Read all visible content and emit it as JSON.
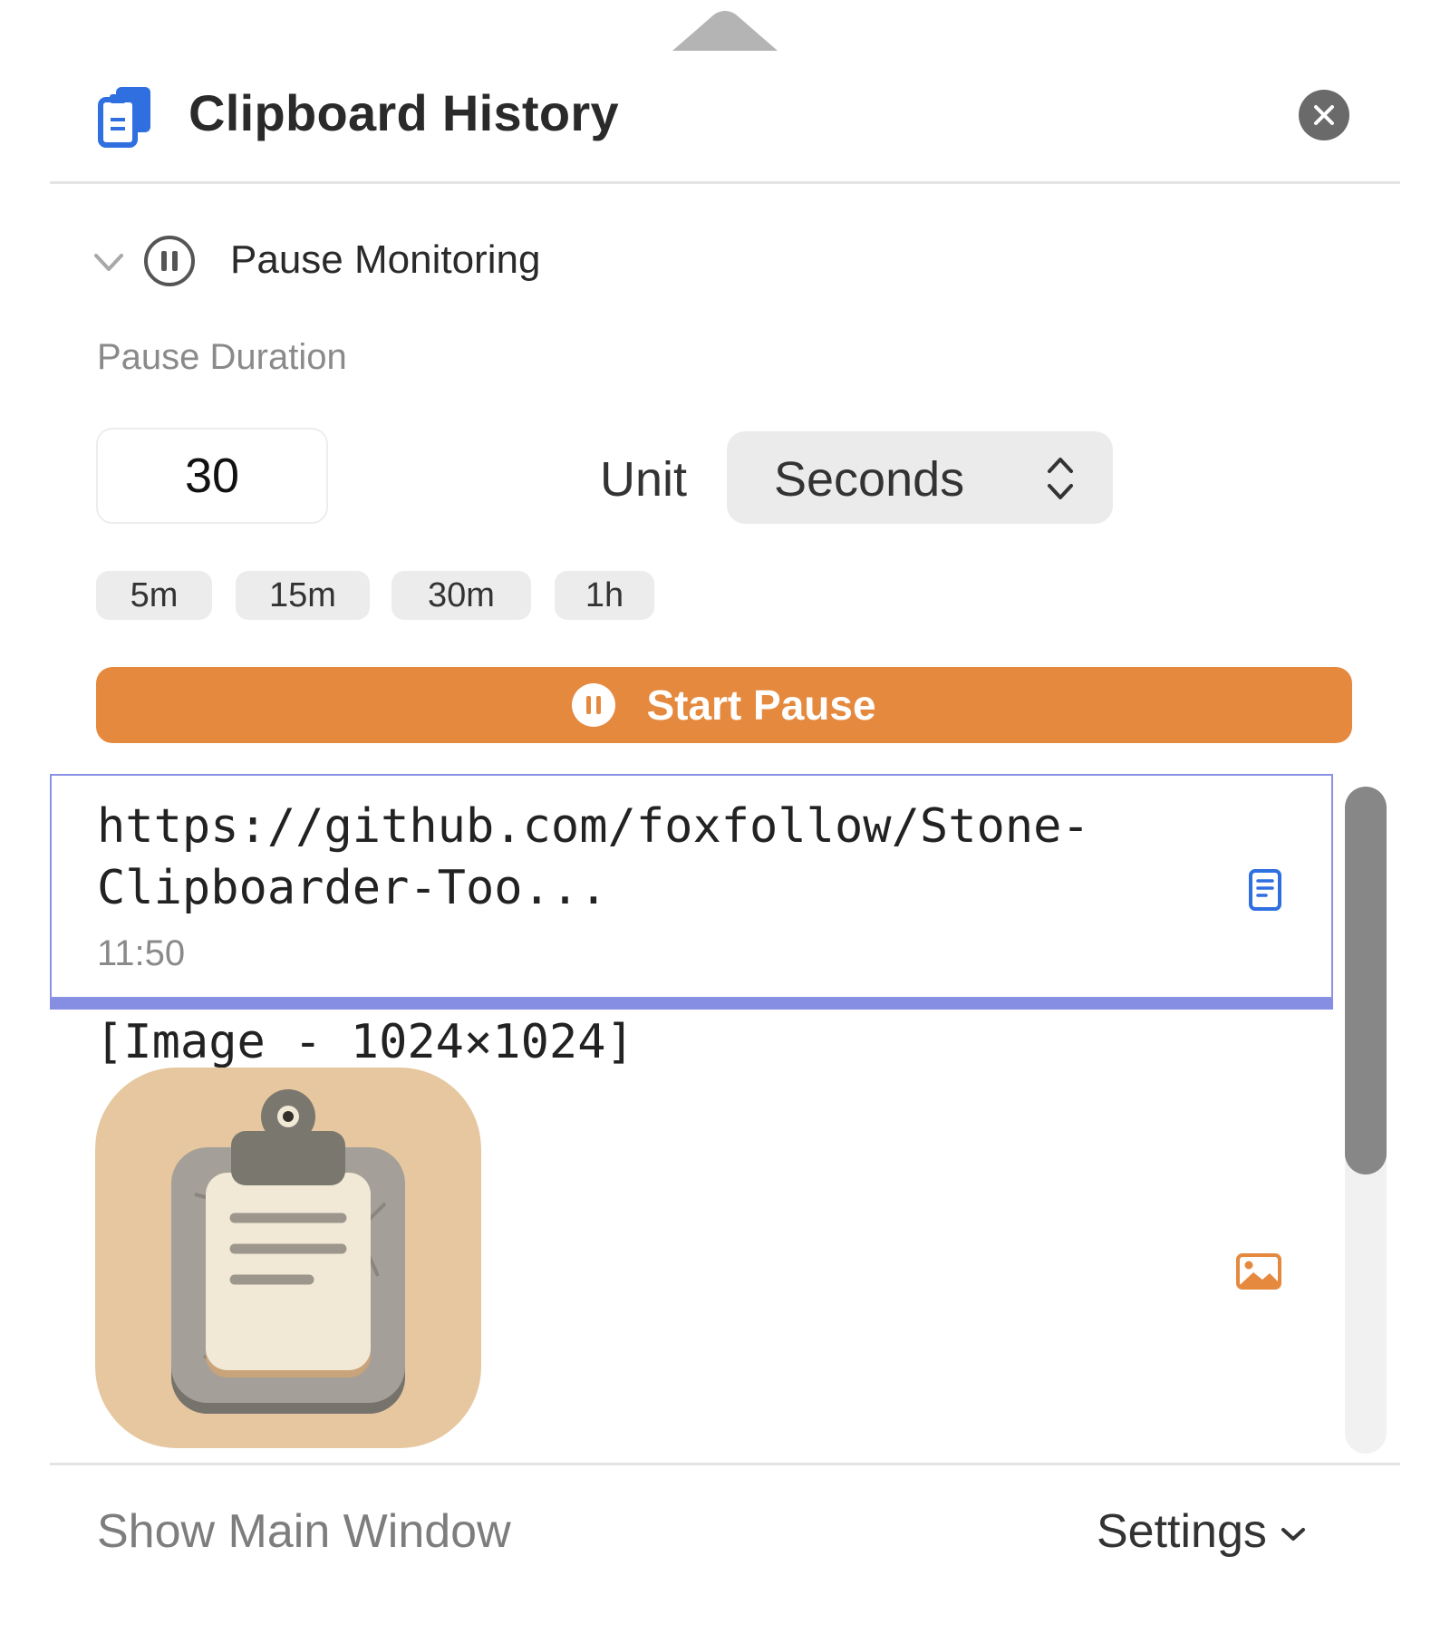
{
  "header": {
    "title": "Clipboard History",
    "app_icon": "clipboard-icon",
    "close_icon": "close-icon"
  },
  "pause": {
    "section_label": "Pause Monitoring",
    "duration_label": "Pause Duration",
    "duration_value": "30",
    "unit_label": "Unit",
    "unit_value": "Seconds",
    "presets": [
      "5m",
      "15m",
      "30m",
      "1h"
    ],
    "start_label": "Start Pause",
    "start_color": "#e5893f"
  },
  "items": [
    {
      "text_line1": "https://github.com/foxfollow/Stone-",
      "text_line2": "Clipboarder-Too...",
      "time": "11:50",
      "type_icon": "document-icon"
    },
    {
      "text_line1": "[Image - 1024×1024]",
      "type_icon": "image-icon"
    }
  ],
  "footer": {
    "show_main": "Show Main Window",
    "settings": "Settings"
  },
  "colors": {
    "accent_blue": "#2f6fe0",
    "selection": "#868ee4",
    "orange": "#e5893f"
  }
}
